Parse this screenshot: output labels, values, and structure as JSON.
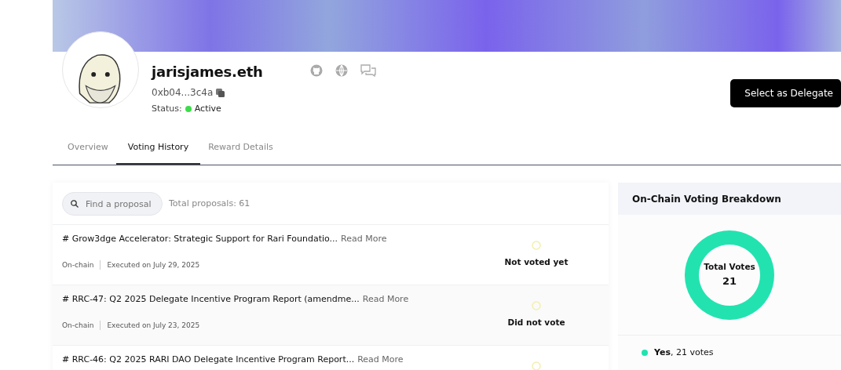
{
  "profile": {
    "name": "jarisjames.eth",
    "address": "0xb04...3c4a",
    "status_label": "Status:",
    "status": "Active",
    "online": true
  },
  "delegate_button": "Select as Delegate",
  "tabs": [
    {
      "label": "Overview",
      "selected": false
    },
    {
      "label": "Voting History",
      "selected": true
    },
    {
      "label": "Reward Details",
      "selected": false
    }
  ],
  "search": {
    "placeholder": "Find a proposal"
  },
  "total_proposals": "Total proposals: 61",
  "proposals": [
    {
      "title": "# Grow3dge Accelerator: Strategic Support for Rari Foundatio...",
      "read_more": "Read More",
      "type": "On-chain",
      "date": "Executed on July 29, 2025",
      "vote_status": "Not voted yet"
    },
    {
      "title": "# RRC-47: Q2 2025 Delegate Incentive Program Report (amendme...",
      "read_more": "Read More",
      "type": "On-chain",
      "date": "Executed on July 23, 2025",
      "vote_status": "Did not vote"
    },
    {
      "title": "# RRC-46: Q2 2025 RARI DAO Delegate Incentive Program Report...",
      "read_more": "Read More"
    }
  ],
  "breakdown": {
    "title": "On-Chain Voting Breakdown",
    "center_label": "Total Votes",
    "center_value": "21",
    "legend": [
      {
        "text": "**Yes**, 21 votes",
        "color": "#22e3b0"
      }
    ]
  }
}
